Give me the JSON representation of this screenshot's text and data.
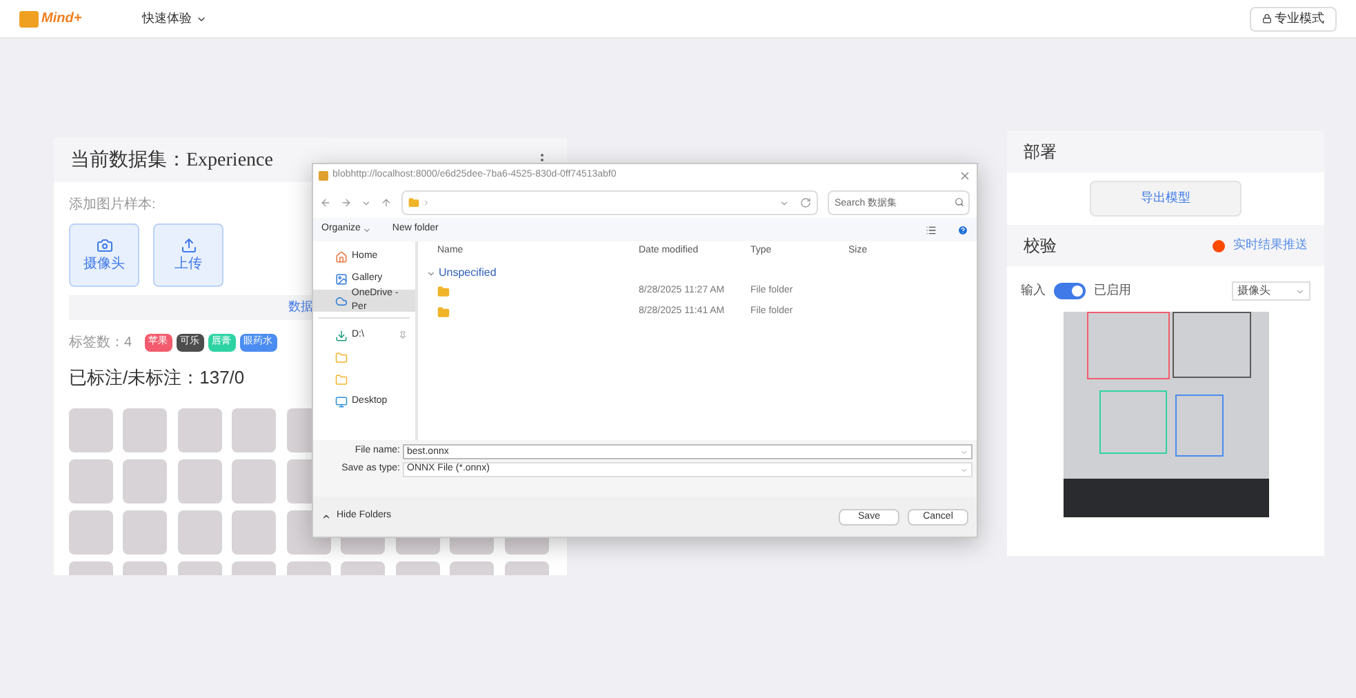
{
  "header": {
    "logo": "Mind+",
    "menu": "快速体验",
    "pro_button": "专业模式"
  },
  "dataset_panel": {
    "title": "当前数据集：",
    "dataset_name": "Experience",
    "add_label": "添加图片样本:",
    "add_buttons": [
      {
        "kind": "camera",
        "label": "摄像头"
      },
      {
        "kind": "upload",
        "label": "上传"
      }
    ],
    "bar_text": "数据",
    "tag_count": "标签数：4",
    "tags": [
      {
        "label": "苹果",
        "color": "#f25c6e"
      },
      {
        "label": "可乐",
        "color": "#4d4d4d"
      },
      {
        "label": "唇膏",
        "color": "#2ed3a4"
      },
      {
        "label": "眼药水",
        "color": "#4a8cf0"
      }
    ],
    "annotated": "已标注/未标注：137/0"
  },
  "save_dialog": {
    "title": "blobhttp://localhost:8000/e6d25dee-7ba6-4525-830d-0ff74513abf0",
    "search_placeholder": "Search 数据集",
    "toolbar": [
      "Organize",
      "New folder"
    ],
    "nav": [
      {
        "kind": "home",
        "label": "Home",
        "selected": false
      },
      {
        "kind": "gallery",
        "label": "Gallery",
        "selected": false
      },
      {
        "kind": "cloud",
        "label": "OneDrive - Per",
        "selected": true
      },
      {
        "kind": "download",
        "label": "D:\\",
        "selected": false
      },
      {
        "kind": "folder",
        "selected": false
      },
      {
        "kind": "folder",
        "selected": false
      },
      {
        "kind": "desktop",
        "label": "Desktop",
        "selected": false
      }
    ],
    "columns": [
      "Name",
      "Date modified",
      "Type",
      "Size"
    ],
    "group": "Unspecified",
    "files": [
      {
        "date": "8/28/2025 11:27 AM",
        "type": "File folder"
      },
      {
        "date": "8/28/2025 11:41 AM",
        "type": "File folder"
      }
    ],
    "file_name_label": "File name:",
    "file_name": "best.onnx",
    "type_label": "Save as type:",
    "file_type": "ONNX File (*.onnx)",
    "hide_folders": "Hide Folders",
    "buttons": [
      "Save",
      "Cancel"
    ]
  },
  "deploy_panel": {
    "title": "部署",
    "export_button": "导出模型"
  },
  "verify_panel": {
    "title": "校验",
    "push_link": "实时结果推送",
    "input_label": "输入",
    "input_on": true,
    "input_state": "已启用",
    "source": "摄像头"
  }
}
